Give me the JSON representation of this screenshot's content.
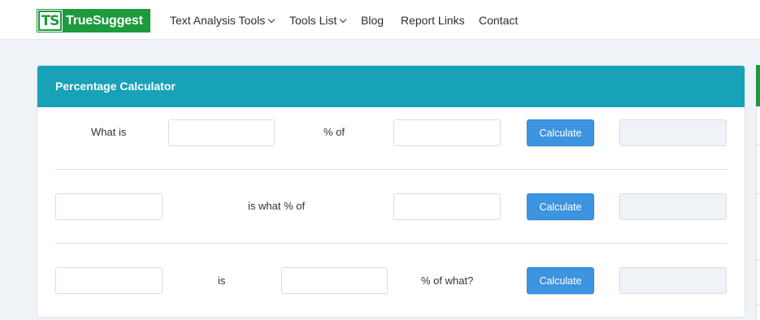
{
  "brand": {
    "logo_mark": "TS",
    "name": "TrueSuggest"
  },
  "nav": {
    "items": [
      {
        "label": "Text Analysis Tools",
        "dropdown": true
      },
      {
        "label": "Tools List",
        "dropdown": true
      },
      {
        "label": "Blog"
      },
      {
        "label": "Report Links"
      },
      {
        "label": "Contact"
      }
    ]
  },
  "calculator": {
    "title": "Percentage Calculator",
    "row1": {
      "prefix": "What is",
      "middle": "% of",
      "button": "Calculate",
      "value_a": "",
      "value_b": "",
      "result": ""
    },
    "row2": {
      "middle": "is what % of",
      "button": "Calculate",
      "value_a": "",
      "value_b": "",
      "result": ""
    },
    "row3": {
      "middle": "is",
      "suffix": "% of what?",
      "button": "Calculate",
      "value_a": "",
      "value_b": "",
      "result": ""
    }
  },
  "colors": {
    "header": "#17a2b8",
    "button": "#3d94e0",
    "brand": "#1c9a3d",
    "page_bg": "#eff2f6"
  }
}
